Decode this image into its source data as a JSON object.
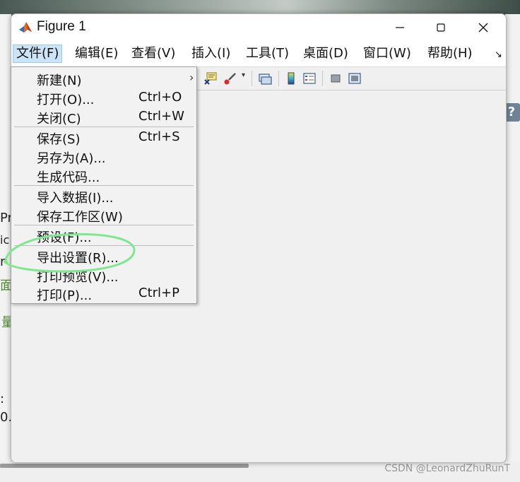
{
  "window": {
    "title": "Figure 1",
    "controls": {
      "minimize": "minimize-icon",
      "maximize": "maximize-icon",
      "close": "close-icon"
    }
  },
  "menubar": {
    "items": [
      {
        "label": "文件(F)"
      },
      {
        "label": "编辑(E)"
      },
      {
        "label": "查看(V)"
      },
      {
        "label": "插入(I)"
      },
      {
        "label": "工具(T)"
      },
      {
        "label": "桌面(D)"
      },
      {
        "label": "窗口(W)"
      },
      {
        "label": "帮助(H)"
      }
    ],
    "more_icon": "chevron-more-icon"
  },
  "toolbar": {
    "icons": [
      "data-tips-icon",
      "brush-icon",
      "link-plot-icon",
      "colorbar-icon",
      "legend-icon",
      "hide-plot-tools-icon",
      "show-plot-tools-icon"
    ]
  },
  "file_menu": {
    "items": [
      {
        "label": "新建(N)",
        "shortcut": "",
        "submenu": true
      },
      {
        "label": "打开(O)...",
        "shortcut": "Ctrl+O"
      },
      {
        "label": "关闭(C)",
        "shortcut": "Ctrl+W"
      },
      {
        "label": "保存(S)",
        "shortcut": "Ctrl+S"
      },
      {
        "label": "另存为(A)...",
        "shortcut": ""
      },
      {
        "label": "生成代码...",
        "shortcut": ""
      },
      {
        "label": "导入数据(I)...",
        "shortcut": ""
      },
      {
        "label": "保存工作区(W)",
        "shortcut": ""
      },
      {
        "label": "预设(F)...",
        "shortcut": ""
      },
      {
        "label": "导出设置(R)...",
        "shortcut": ""
      },
      {
        "label": "打印预览(V)...",
        "shortcut": ""
      },
      {
        "label": "打印(P)...",
        "shortcut": "Ctrl+P"
      }
    ],
    "annotation_color": "#7ee88f"
  },
  "background": {
    "fragments": [
      "Pr",
      "ic",
      "r",
      "面",
      "量",
      ":",
      "0."
    ],
    "watermark": "CSDN @LeonardZhuRunT"
  },
  "colors": {
    "menu_open_bg": "#cce4f7",
    "window_bg": "#f0f0f0",
    "titlebar_bg": "#ffffff"
  }
}
